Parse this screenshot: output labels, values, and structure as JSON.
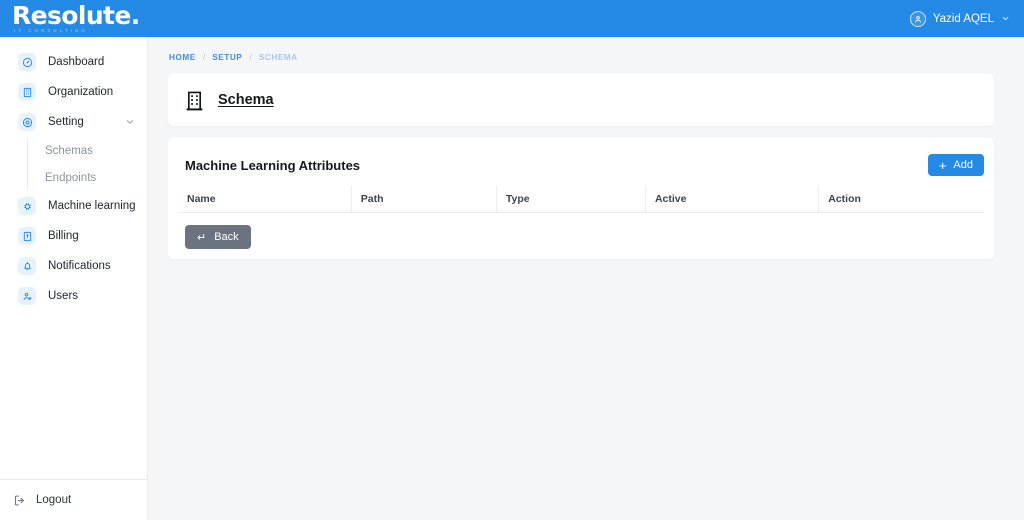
{
  "brand": {
    "name": "Resolute.",
    "tagline": "IT CONSULTING",
    "header_color": "#2589e6"
  },
  "header": {
    "user_name": "Yazid AQEL",
    "avatar_icon": "user-circle-icon",
    "caret_icon": "chevron-down-icon"
  },
  "sidebar": {
    "items": [
      {
        "label": "Dashboard",
        "icon": "speedometer-icon"
      },
      {
        "label": "Organization",
        "icon": "building-icon"
      },
      {
        "label": "Setting",
        "icon": "gear-icon",
        "expanded": true,
        "chevron": "chevron-down-icon"
      },
      {
        "label": "Machine learning",
        "icon": "cpu-chip-icon"
      },
      {
        "label": "Billing",
        "icon": "billing-card-icon"
      },
      {
        "label": "Notifications",
        "icon": "bell-icon"
      },
      {
        "label": "Users",
        "icon": "users-icon"
      }
    ],
    "subitems": [
      {
        "label": "Schemas"
      },
      {
        "label": "Endpoints"
      }
    ],
    "logout": {
      "label": "Logout",
      "icon": "sign-out-icon"
    }
  },
  "breadcrumb": {
    "items": [
      "HOME",
      "SETUP",
      "SCHEMA"
    ],
    "separator": "/"
  },
  "schema_card": {
    "title": "Schema",
    "icon": "building-office-icon"
  },
  "attributes_card": {
    "title": "Machine Learning Attributes",
    "add_button": {
      "label": "Add",
      "icon": "plus-icon"
    },
    "back_button": {
      "label": "Back",
      "icon": "return-arrow-icon"
    },
    "columns": [
      "Name",
      "Path",
      "Type",
      "Active",
      "Action"
    ],
    "rows": []
  },
  "colors": {
    "accent": "#2589e6",
    "page_background": "#f5f6f8",
    "card_background": "#ffffff",
    "back_button": "#6b7380",
    "muted_text": "#8c949f"
  }
}
